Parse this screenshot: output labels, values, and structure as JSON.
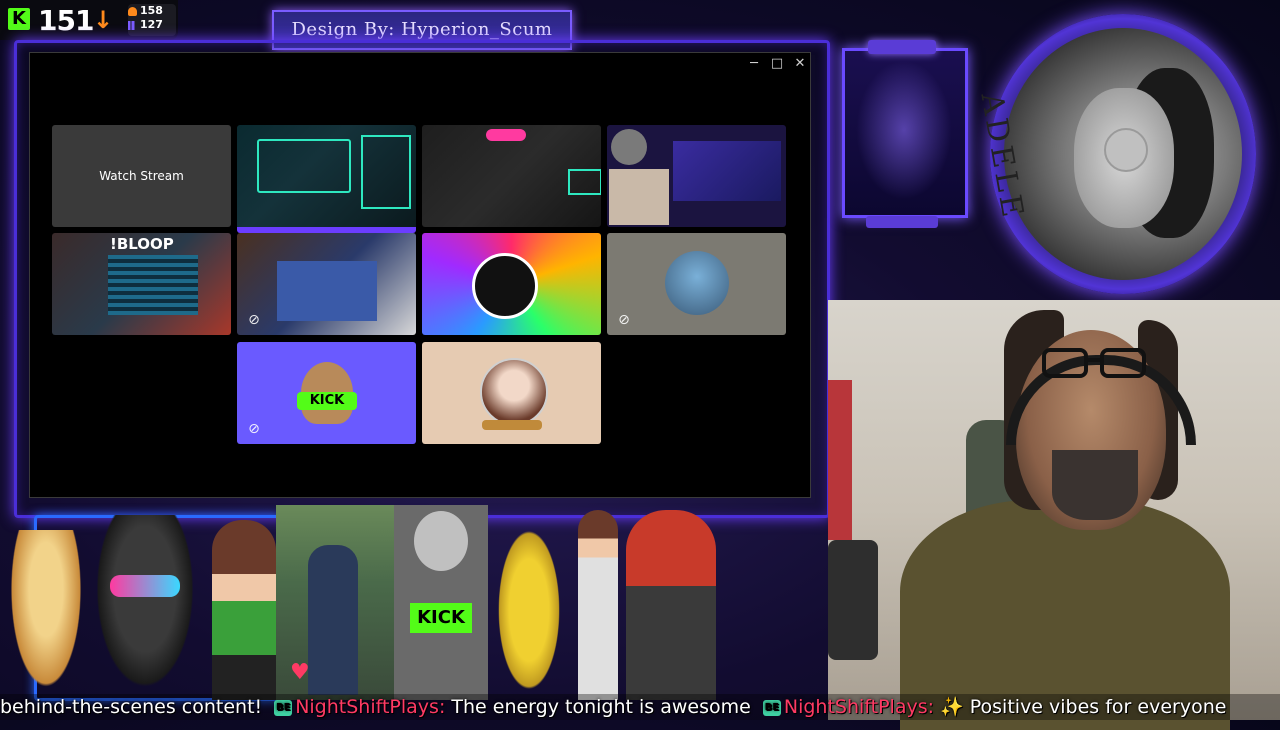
{
  "kick_counter": {
    "viewer_count": "151",
    "stat_1": "158",
    "stat_2": "127"
  },
  "banner": {
    "text": "Design By: Hyperion_Scum"
  },
  "window": {
    "controls": [
      "─",
      "□",
      "✕"
    ]
  },
  "tiles": {
    "watch_stream_label": "Watch Stream",
    "bloop_label": "!BLOOP",
    "kick_badge": "KICK",
    "tile_10_label": "KICK"
  },
  "adele": {
    "text": "ADELE"
  },
  "characters": {
    "kick_sign": "KICK"
  },
  "ticker": {
    "segment_1": "behind-the-scenes content!",
    "badge": "BE",
    "user_1": "NightShiftPlays:",
    "message_1": " The energy tonight is awesome",
    "user_2": "NightShiftPlays:",
    "message_2": " ✨ Positive vibes for everyone"
  },
  "colors": {
    "kick_green": "#53fc18",
    "accent_purple": "#6b3dff",
    "ticker_user": "#ff3a64",
    "arrow_orange": "#ff8a1c"
  }
}
